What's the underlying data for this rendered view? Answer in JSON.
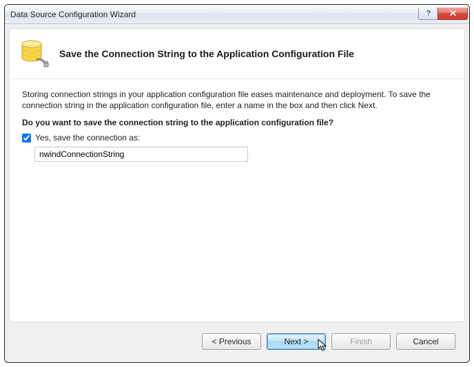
{
  "window": {
    "title": "Data Source Configuration Wizard"
  },
  "header": {
    "title": "Save the Connection String to the Application Configuration File"
  },
  "body": {
    "intro": "Storing connection strings in your application configuration file eases maintenance and deployment. To save the connection string in the application configuration file, enter a name in the box and then click Next.",
    "question": "Do you want to save the connection string to the application configuration file?",
    "checkbox_label": "Yes, save the connection as:",
    "connection_name": "nwindConnectionString"
  },
  "footer": {
    "previous": "< Previous",
    "next": "Next >",
    "finish": "Finish",
    "cancel": "Cancel"
  }
}
